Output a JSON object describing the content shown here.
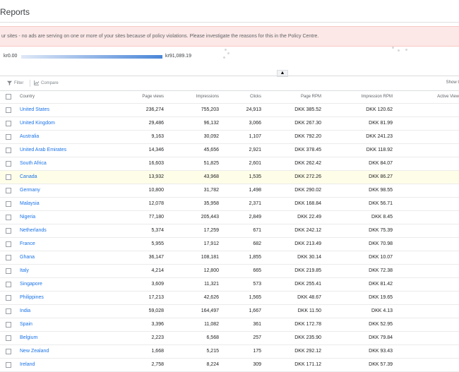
{
  "page": {
    "title": "Reports"
  },
  "alert": {
    "text": "ur sites - no ads are serving on one or more of your sites because of policy violations. Please investigate the reasons for this in the Policy Centre."
  },
  "map": {
    "legend_min": "kr0.00",
    "legend_max": "kr91,089.19",
    "collapse_icon": "▲"
  },
  "toolbar": {
    "filter_label": "Filter",
    "compare_label": "Compare",
    "show_label": "Show t"
  },
  "table": {
    "columns": [
      "Country",
      "Page views",
      "Impressions",
      "Clicks",
      "Page RPM",
      "Impression RPM",
      "Active View"
    ],
    "rows": [
      {
        "country": "United States",
        "page_views": "236,274",
        "impressions": "755,203",
        "clicks": "24,913",
        "page_rpm": "DKK 385.52",
        "impression_rpm": "DKK 120.62"
      },
      {
        "country": "United Kingdom",
        "page_views": "29,486",
        "impressions": "96,132",
        "clicks": "3,066",
        "page_rpm": "DKK 267.30",
        "impression_rpm": "DKK 81.99"
      },
      {
        "country": "Australia",
        "page_views": "9,163",
        "impressions": "30,092",
        "clicks": "1,107",
        "page_rpm": "DKK 792.20",
        "impression_rpm": "DKK 241.23"
      },
      {
        "country": "United Arab Emirates",
        "page_views": "14,346",
        "impressions": "45,656",
        "clicks": "2,921",
        "page_rpm": "DKK 378.45",
        "impression_rpm": "DKK 118.92"
      },
      {
        "country": "South Africa",
        "page_views": "16,603",
        "impressions": "51,825",
        "clicks": "2,601",
        "page_rpm": "DKK 262.42",
        "impression_rpm": "DKK 84.07"
      },
      {
        "country": "Canada",
        "page_views": "13,932",
        "impressions": "43,968",
        "clicks": "1,535",
        "page_rpm": "DKK 272.26",
        "impression_rpm": "DKK 86.27"
      },
      {
        "country": "Germany",
        "page_views": "10,800",
        "impressions": "31,782",
        "clicks": "1,498",
        "page_rpm": "DKK 290.02",
        "impression_rpm": "DKK 98.55"
      },
      {
        "country": "Malaysia",
        "page_views": "12,078",
        "impressions": "35,958",
        "clicks": "2,371",
        "page_rpm": "DKK 168.84",
        "impression_rpm": "DKK 56.71"
      },
      {
        "country": "Nigeria",
        "page_views": "77,180",
        "impressions": "205,443",
        "clicks": "2,849",
        "page_rpm": "DKK 22.49",
        "impression_rpm": "DKK 8.45"
      },
      {
        "country": "Netherlands",
        "page_views": "5,374",
        "impressions": "17,259",
        "clicks": "671",
        "page_rpm": "DKK 242.12",
        "impression_rpm": "DKK 75.39"
      },
      {
        "country": "France",
        "page_views": "5,955",
        "impressions": "17,912",
        "clicks": "682",
        "page_rpm": "DKK 213.49",
        "impression_rpm": "DKK 70.98"
      },
      {
        "country": "Ghana",
        "page_views": "36,147",
        "impressions": "108,181",
        "clicks": "1,855",
        "page_rpm": "DKK 30.14",
        "impression_rpm": "DKK 10.07"
      },
      {
        "country": "Italy",
        "page_views": "4,214",
        "impressions": "12,800",
        "clicks": "665",
        "page_rpm": "DKK 219.85",
        "impression_rpm": "DKK 72.38"
      },
      {
        "country": "Singapore",
        "page_views": "3,609",
        "impressions": "11,321",
        "clicks": "573",
        "page_rpm": "DKK 255.41",
        "impression_rpm": "DKK 81.42"
      },
      {
        "country": "Philippines",
        "page_views": "17,213",
        "impressions": "42,626",
        "clicks": "1,565",
        "page_rpm": "DKK 48.67",
        "impression_rpm": "DKK 19.65"
      },
      {
        "country": "India",
        "page_views": "59,028",
        "impressions": "164,497",
        "clicks": "1,667",
        "page_rpm": "DKK 11.50",
        "impression_rpm": "DKK 4.13"
      },
      {
        "country": "Spain",
        "page_views": "3,396",
        "impressions": "11,082",
        "clicks": "361",
        "page_rpm": "DKK 172.78",
        "impression_rpm": "DKK 52.95"
      },
      {
        "country": "Belgium",
        "page_views": "2,223",
        "impressions": "6,568",
        "clicks": "257",
        "page_rpm": "DKK 235.90",
        "impression_rpm": "DKK 79.84"
      },
      {
        "country": "New Zealand",
        "page_views": "1,668",
        "impressions": "5,215",
        "clicks": "175",
        "page_rpm": "DKK 292.12",
        "impression_rpm": "DKK 93.43"
      },
      {
        "country": "Ireland",
        "page_views": "2,758",
        "impressions": "8,224",
        "clicks": "309",
        "page_rpm": "DKK 171.12",
        "impression_rpm": "DKK 57.39"
      }
    ]
  },
  "colors": {
    "link": "#1a73e8",
    "alert_bg": "#fce8e6",
    "legend_low": "#dfe8f7",
    "legend_high": "#4a86d8",
    "highlight_row": "#fefde8"
  },
  "icons": {
    "filter": "filter-icon",
    "compare": "compare-icon",
    "collapse": "chevron-up-icon"
  }
}
